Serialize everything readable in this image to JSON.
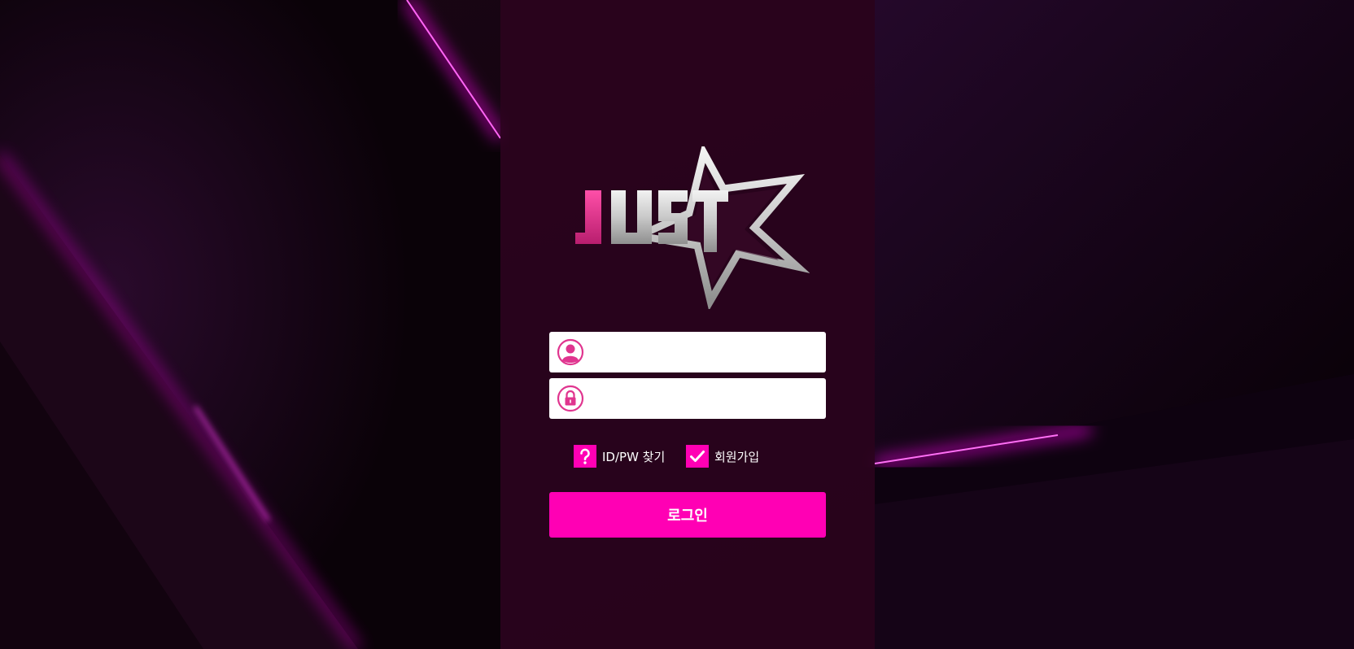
{
  "brand": {
    "logo_text": "JUST",
    "accent_color": "#ff00b4",
    "logo_j_color": "#e0358f",
    "logo_silver_color": "#d8d8d8"
  },
  "login_form": {
    "username": {
      "icon": "user-icon",
      "value": "",
      "placeholder": ""
    },
    "password": {
      "icon": "lock-icon",
      "value": "",
      "placeholder": ""
    },
    "find_account_icon": "question-icon",
    "find_account_label": "ID/PW 찾기",
    "signup_icon": "check-icon",
    "signup_label": "회원가입",
    "login_label": "로그인"
  }
}
